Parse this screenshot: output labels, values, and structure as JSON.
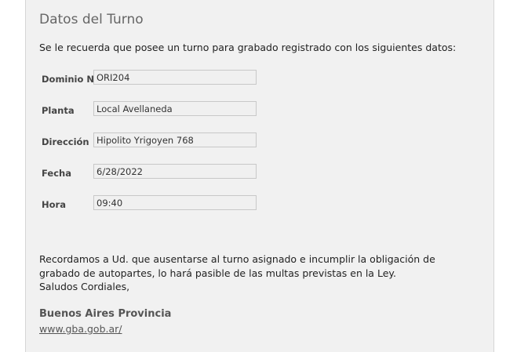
{
  "card": {
    "title": "Datos del Turno",
    "intro": "Se le recuerda que posee un turno para grabado registrado con los siguientes datos:",
    "fields": [
      {
        "label": "Dominio Nº",
        "value": "ORI204"
      },
      {
        "label": "Planta",
        "value": "Local Avellaneda"
      },
      {
        "label": "Dirección",
        "value": "Hipolito Yrigoyen 768"
      },
      {
        "label": "Fecha",
        "value": "6/28/2022"
      },
      {
        "label": "Hora",
        "value": "09:40"
      }
    ],
    "notice_line1": "Recordamos a Ud. que ausentarse al turno asignado e incumplir la obligación de grabado de autopartes, lo hará pasible de las multas previstas en la Ley.",
    "notice_line2": "Saludos Cordiales,",
    "signature": "Buenos Aires Provincia",
    "link": "www.gba.gob.ar/"
  }
}
